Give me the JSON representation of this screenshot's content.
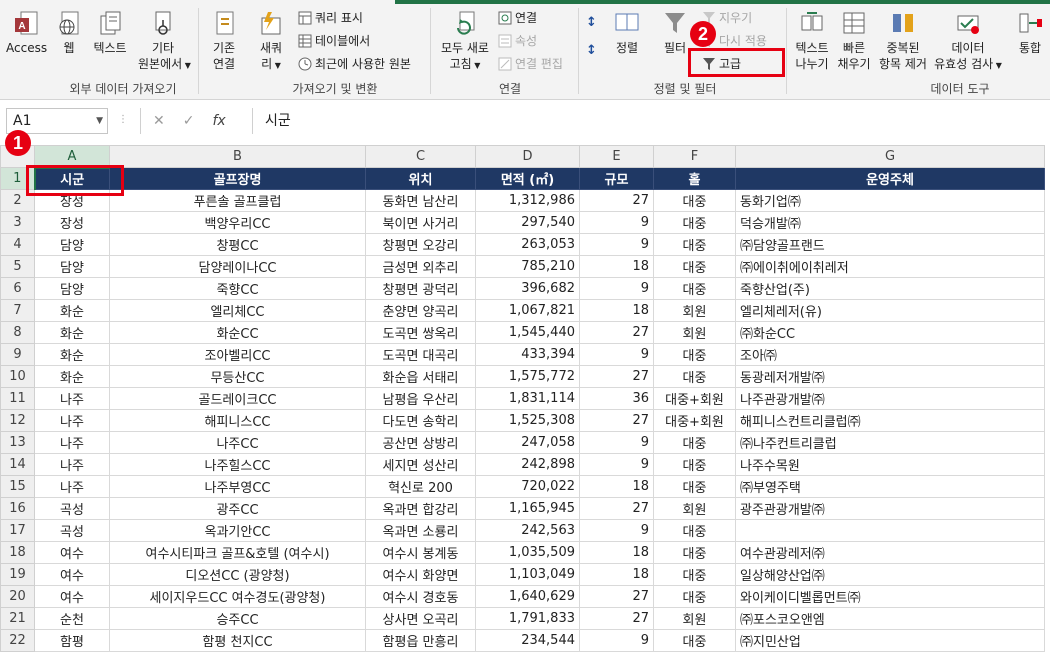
{
  "ribbon": {
    "groups": {
      "external": "외부 데이터 가져오기",
      "transform": "가져오기 및 변환",
      "connections": "연결",
      "sort_filter": "정렬 및 필터",
      "data_tools": "데이터 도구"
    },
    "external": {
      "access": "Access",
      "web": "웹",
      "text": "텍스트",
      "other_1": "기타",
      "other_2": "원본에서"
    },
    "transform": {
      "existing_1": "기존",
      "existing_2": "연결",
      "new_1": "새쿼",
      "new_2": "리",
      "show_queries": "쿼리 표시",
      "from_table": "테이블에서",
      "recent_sources": "최근에 사용한 원본"
    },
    "connections": {
      "refresh_1": "모두 새로",
      "refresh_2": "고침",
      "connections": "연결",
      "properties": "속성",
      "edit_links": "연결 편집"
    },
    "sort_filter": {
      "sort": "정렬",
      "filter": "필터",
      "clear": "지우기",
      "reapply": "다시 적용",
      "advanced": "고급"
    },
    "data_tools": {
      "text_to_cols_1": "텍스트",
      "text_to_cols_2": "나누기",
      "flash_fill_1": "빠른",
      "flash_fill_2": "채우기",
      "remove_dup_1": "중복된",
      "remove_dup_2": "항목 제거",
      "validation_1": "데이터",
      "validation_2": "유효성 검사",
      "consolidate": "통합"
    }
  },
  "formula_bar": {
    "name_box": "A1",
    "formula": "시군",
    "fx": "fx"
  },
  "annotations": {
    "badge1": "1",
    "badge2": "2"
  },
  "sheet": {
    "col_headers": [
      "A",
      "B",
      "C",
      "D",
      "E",
      "F",
      "G"
    ],
    "header_row": [
      "시군",
      "골프장명",
      "위치",
      "면적 (㎡)",
      "규모",
      "홀",
      "운영주체"
    ],
    "rows": [
      [
        "장성",
        "푸른솔 골프클럽",
        "동화면 남산리",
        "1,312,986",
        "27",
        "대중",
        "동화기업㈜"
      ],
      [
        "장성",
        "백양우리CC",
        "북이면 사거리",
        "297,540",
        "9",
        "대중",
        "덕승개발㈜"
      ],
      [
        "담양",
        "창평CC",
        "창평면 오강리",
        "263,053",
        "9",
        "대중",
        "㈜담양골프랜드"
      ],
      [
        "담양",
        "담양레이나CC",
        "금성면 외추리",
        "785,210",
        "18",
        "대중",
        "㈜에이취에이취레저"
      ],
      [
        "담양",
        "죽향CC",
        "창평면 광덕리",
        "396,682",
        "9",
        "대중",
        "죽향산업(주)"
      ],
      [
        "화순",
        "엘리체CC",
        "춘양면 양곡리",
        "1,067,821",
        "18",
        "회원",
        "엘리체레저(유)"
      ],
      [
        "화순",
        "화순CC",
        "도곡면 쌍옥리",
        "1,545,440",
        "27",
        "회원",
        "㈜화순CC"
      ],
      [
        "화순",
        "조아벨리CC",
        "도곡면 대곡리",
        "433,394",
        "9",
        "대중",
        "조아㈜"
      ],
      [
        "화순",
        "무등산CC",
        "화순읍 서태리",
        "1,575,772",
        "27",
        "대중",
        "동광레저개발㈜"
      ],
      [
        "나주",
        "골드레이크CC",
        "남평읍 우산리",
        "1,831,114",
        "36",
        "대중+회원",
        "나주관광개발㈜"
      ],
      [
        "나주",
        "해피니스CC",
        "다도면 송학리",
        "1,525,308",
        "27",
        "대중+회원",
        "해피니스컨트리클럽㈜"
      ],
      [
        "나주",
        "나주CC",
        "공산면 상방리",
        "247,058",
        "9",
        "대중",
        "㈜나주컨트리클럽"
      ],
      [
        "나주",
        "나주힐스CC",
        "세지면 성산리",
        "242,898",
        "9",
        "대중",
        "나주수목원"
      ],
      [
        "나주",
        "나주부영CC",
        "혁신로 200",
        "720,022",
        "18",
        "대중",
        "㈜부영주택"
      ],
      [
        "곡성",
        "광주CC",
        "옥과면 합강리",
        "1,165,945",
        "27",
        "회원",
        "광주관광개발㈜"
      ],
      [
        "곡성",
        "옥과기안CC",
        "옥과면 소룡리",
        "242,563",
        "9",
        "대중",
        ""
      ],
      [
        "여수",
        "여수시티파크 골프&호텔 (여수시)",
        "여수시 봉계동",
        "1,035,509",
        "18",
        "대중",
        "여수관광레저㈜"
      ],
      [
        "여수",
        "디오션CC (광양청)",
        "여수시 화양면",
        "1,103,049",
        "18",
        "대중",
        "일상해양산업㈜"
      ],
      [
        "여수",
        "세이지우드CC 여수경도(광양청)",
        "여수시 경호동",
        "1,640,629",
        "27",
        "대중",
        "와이케이디벨롭먼트㈜"
      ],
      [
        "순천",
        "승주CC",
        "상사면 오곡리",
        "1,791,833",
        "27",
        "회원",
        "㈜포스코오앤엠"
      ],
      [
        "함평",
        "함평 천지CC",
        "함평읍 만흥리",
        "234,544",
        "9",
        "대중",
        "㈜지민산업"
      ]
    ]
  }
}
